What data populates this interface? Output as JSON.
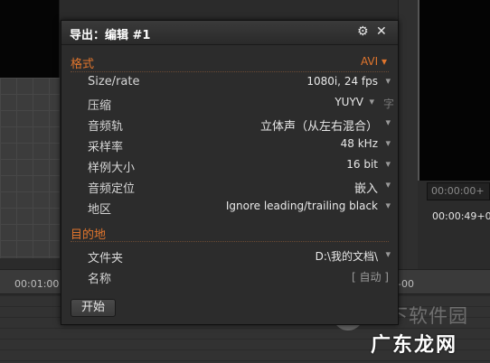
{
  "background": {
    "timecode_box": "00:00:00+",
    "timecode": "00:00:49+0",
    "ruler_left": "00:01:00",
    "ruler_right": "-00"
  },
  "watermark": {
    "line1": "当下软件园",
    "line2": "广东龙网"
  },
  "dialog": {
    "title": "导出：编辑 #1",
    "format_section": {
      "label": "格式",
      "value": "AVI"
    },
    "format_rows": [
      {
        "label": "Size/rate",
        "value": "1080i, 24 fps"
      },
      {
        "label": "压缩",
        "value": "YUYV",
        "extra": "字"
      },
      {
        "label": "音频轨",
        "value": "立体声（从左右混合）"
      },
      {
        "label": "采样率",
        "value": "48 kHz"
      },
      {
        "label": "样例大小",
        "value": "16 bit"
      },
      {
        "label": "音频定位",
        "value": "嵌入"
      },
      {
        "label": "地区",
        "value": "Ignore leading/trailing black"
      }
    ],
    "destination_section": {
      "label": "目的地"
    },
    "destination_rows": [
      {
        "label": "文件夹",
        "value": "D:\\我的文档\\"
      },
      {
        "label": "名称",
        "value": "[ 自动 ]"
      }
    ],
    "start_label": "开始"
  },
  "colors": {
    "accent": "#e0752d",
    "dialog_bg": "#2c2c2c"
  }
}
